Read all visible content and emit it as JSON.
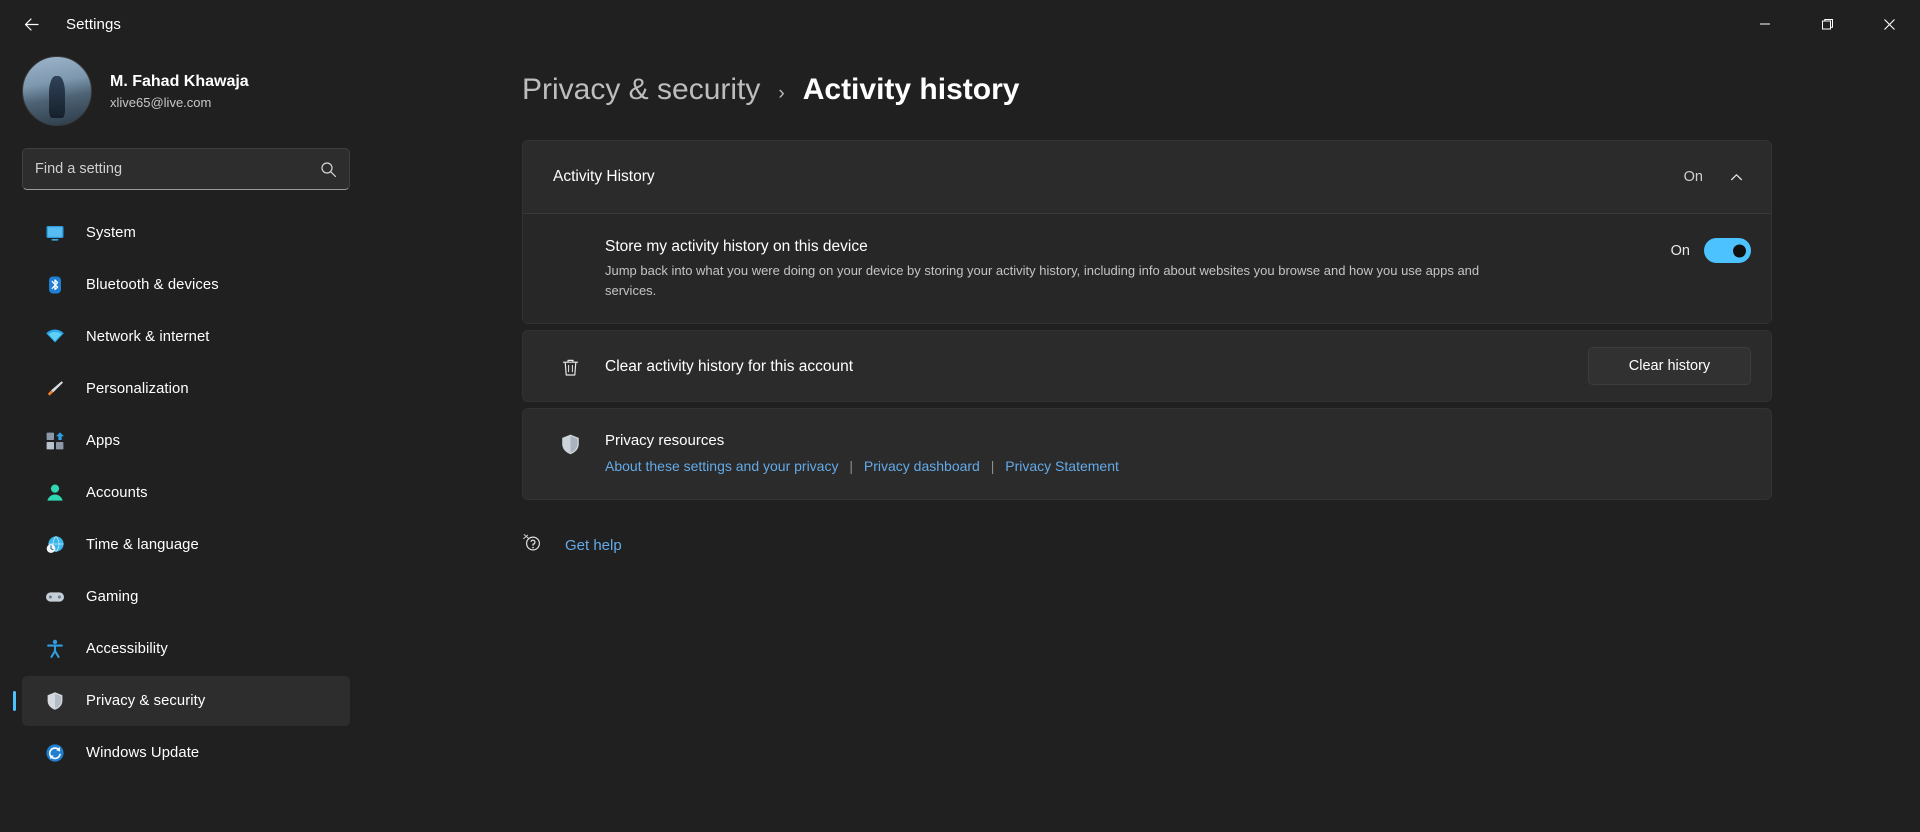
{
  "titlebar": {
    "back_label": "back-arrow",
    "app_title": "Settings",
    "minimize": "minimize-icon",
    "maximize": "maximize-icon",
    "close": "close-icon"
  },
  "sidebar": {
    "profile": {
      "name": "M. Fahad Khawaja",
      "email": "xlive65@live.com"
    },
    "search": {
      "placeholder": "Find a setting",
      "value": "",
      "icon": "search-icon"
    },
    "items": [
      {
        "label": "System",
        "icon": "system-icon",
        "selected": false
      },
      {
        "label": "Bluetooth & devices",
        "icon": "bluetooth-icon",
        "selected": false
      },
      {
        "label": "Network & internet",
        "icon": "network-icon",
        "selected": false
      },
      {
        "label": "Personalization",
        "icon": "personalization-icon",
        "selected": false
      },
      {
        "label": "Apps",
        "icon": "apps-icon",
        "selected": false
      },
      {
        "label": "Accounts",
        "icon": "accounts-icon",
        "selected": false
      },
      {
        "label": "Time & language",
        "icon": "time-language-icon",
        "selected": false
      },
      {
        "label": "Gaming",
        "icon": "gaming-icon",
        "selected": false
      },
      {
        "label": "Accessibility",
        "icon": "accessibility-icon",
        "selected": false
      },
      {
        "label": "Privacy & security",
        "icon": "shield-icon",
        "selected": true
      },
      {
        "label": "Windows Update",
        "icon": "windows-update-icon",
        "selected": false
      }
    ]
  },
  "breadcrumb": {
    "parent": "Privacy & security",
    "separator": "›",
    "current": "Activity history"
  },
  "activity_history": {
    "expander_title": "Activity History",
    "expander_state": "On",
    "chevron": "chevron-up-icon",
    "store_setting": {
      "title": "Store my activity history on this device",
      "description": "Jump back into what you were doing on your device by storing your activity history, including info about websites you browse and how you use apps and services.",
      "toggle_label": "On",
      "toggle_state": "on"
    },
    "clear_row": {
      "icon": "trash-icon",
      "label": "Clear activity history for this account",
      "button_label": "Clear history"
    },
    "privacy_resources": {
      "icon": "shield-icon",
      "title": "Privacy resources",
      "links": [
        "About these settings and your privacy",
        "Privacy dashboard",
        "Privacy Statement"
      ],
      "separator": "|"
    }
  },
  "get_help": {
    "icon": "help-icon",
    "label": "Get help"
  },
  "colors": {
    "accent": "#4cc2ff",
    "link": "#64aae8",
    "page_bg": "#202020",
    "card_bg": "#2b2b2b"
  }
}
